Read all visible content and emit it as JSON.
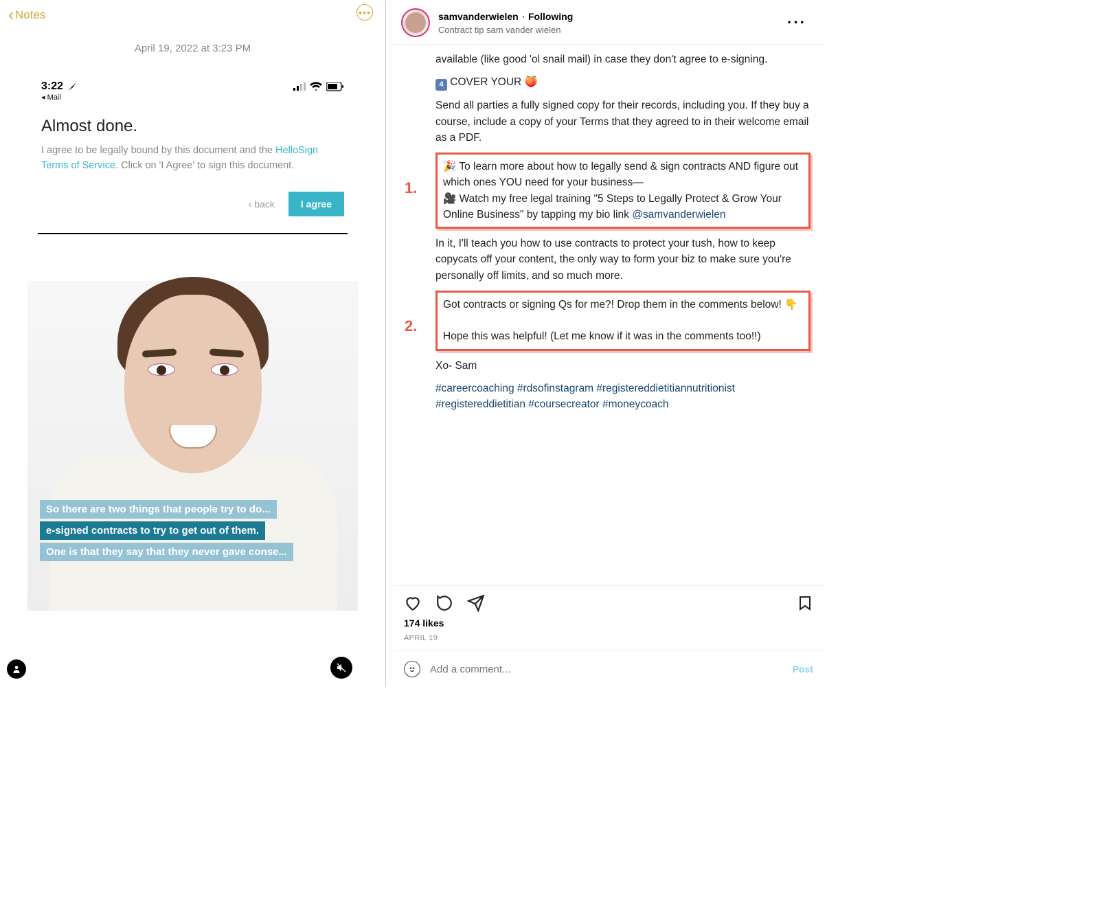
{
  "left": {
    "back_label": "Notes",
    "note_date": "April 19, 2022 at 3:23 PM",
    "phone_time": "3:22",
    "mail_back": "Mail",
    "almost_title": "Almost done.",
    "almost_text_1": "I agree to be legally bound by this document and the ",
    "almost_link": "HelloSign Terms of Service",
    "almost_text_2": ". Click on 'I Agree' to sign this document.",
    "back_btn": "‹ back",
    "agree_btn": "I agree",
    "captions": [
      "So there are two things that people try to do...",
      "e-signed contracts to try to get out of them.",
      "One is that they say that they never gave conse..."
    ]
  },
  "right": {
    "username": "samvanderwielen",
    "following": "Following",
    "subtitle": "Contract tip sam vander wielen",
    "para_top": "available (like good 'ol snail mail) in case they don't agree to e-signing.",
    "cover_num": "4",
    "cover_title": " COVER YOUR ",
    "cover_emoji": "🍑",
    "para_send": "Send all parties a fully signed copy for their records, including you. If they buy a course, include a copy of your Terms that they agreed to in their welcome email as a PDF.",
    "annot1": "1.",
    "hl1_a": "🎉 To learn more about how to legally send & sign contracts AND figure out which ones YOU need for your business—",
    "hl1_b": "🎥 Watch my free legal training \"5 Steps to Legally Protect & Grow Your Online Business\" by tapping my bio link",
    "hl1_mention": "@samvanderwielen",
    "para_mid": "In it, I'll teach you how to use contracts to protect your tush, how to keep copycats off your content, the only way to form your biz to make sure you're personally off limits, and so much more.",
    "annot2": "2.",
    "hl2_a": "Got contracts or signing Qs for me?! Drop them in the comments below! 👇",
    "hl2_b": "Hope this was helpful! (Let me know if it was in the comments too!!)",
    "signoff": "Xo- Sam",
    "hashtags": "#careercoaching #rdsofinstagram #registereddietitiannutritionist #registereddietitian #coursecreator #moneycoach",
    "likes": "174 likes",
    "date": "APRIL 19",
    "comment_placeholder": "Add a comment...",
    "post_btn": "Post"
  }
}
